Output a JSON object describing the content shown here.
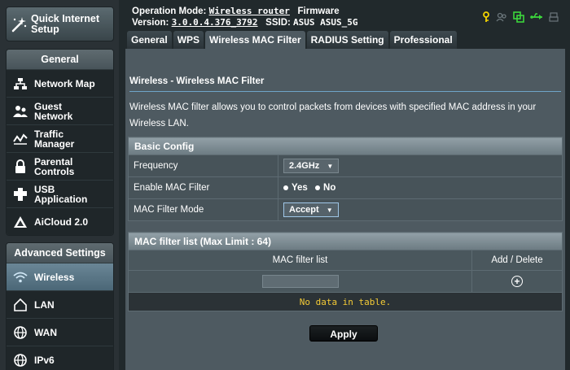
{
  "sidebar": {
    "quick_setup_label_1": "Quick Internet",
    "quick_setup_label_2": "Setup",
    "general_title": "General",
    "general_items": [
      {
        "label": "Network Map",
        "icon": "network-map-icon"
      },
      {
        "label": "Guest Network",
        "icon": "guest-network-icon"
      },
      {
        "label": "Traffic Manager",
        "icon": "traffic-manager-icon"
      },
      {
        "label": "Parental Controls",
        "icon": "parental-controls-icon"
      },
      {
        "label": "USB Application",
        "icon": "usb-application-icon"
      },
      {
        "label": "AiCloud 2.0",
        "icon": "aicloud-icon"
      }
    ],
    "advanced_title": "Advanced Settings",
    "advanced_items": [
      {
        "label": "Wireless",
        "icon": "wireless-icon",
        "active": true
      },
      {
        "label": "LAN",
        "icon": "lan-icon"
      },
      {
        "label": "WAN",
        "icon": "wan-icon"
      },
      {
        "label": "IPv6",
        "icon": "ipv6-icon"
      }
    ]
  },
  "header": {
    "op_mode_label": "Operation Mode:",
    "op_mode_value": "Wireless router",
    "firmware_label": "Firmware",
    "version_label": "Version:",
    "version_value": "3.0.0.4.376_3792",
    "ssid_label": "SSID:",
    "ssid_value": "ASUS ASUS_5G"
  },
  "tabs": [
    "General",
    "WPS",
    "Wireless MAC Filter",
    "RADIUS Setting",
    "Professional"
  ],
  "active_tab": "Wireless MAC Filter",
  "page": {
    "title": "Wireless - Wireless MAC Filter",
    "description": "Wireless MAC filter allows you to control packets from devices with specified MAC address in your Wireless LAN."
  },
  "basic_config": {
    "header": "Basic Config",
    "frequency_label": "Frequency",
    "frequency_value": "2.4GHz",
    "enable_label": "Enable MAC Filter",
    "yes_label": "Yes",
    "no_label": "No",
    "mode_label": "MAC Filter Mode",
    "mode_value": "Accept"
  },
  "mac_list": {
    "header": "MAC filter list (Max Limit : 64)",
    "col_list": "MAC filter list",
    "col_action": "Add / Delete",
    "input_value": "",
    "empty_text": "No data in table."
  },
  "apply_label": "Apply",
  "colors": {
    "background": "#21292c",
    "panel": "#4e5a61",
    "accent_blue": "#6fa5c9",
    "no_data_yellow": "#f4cb36",
    "status_yellow": "#f2d200",
    "status_green": "#3cd63c"
  }
}
